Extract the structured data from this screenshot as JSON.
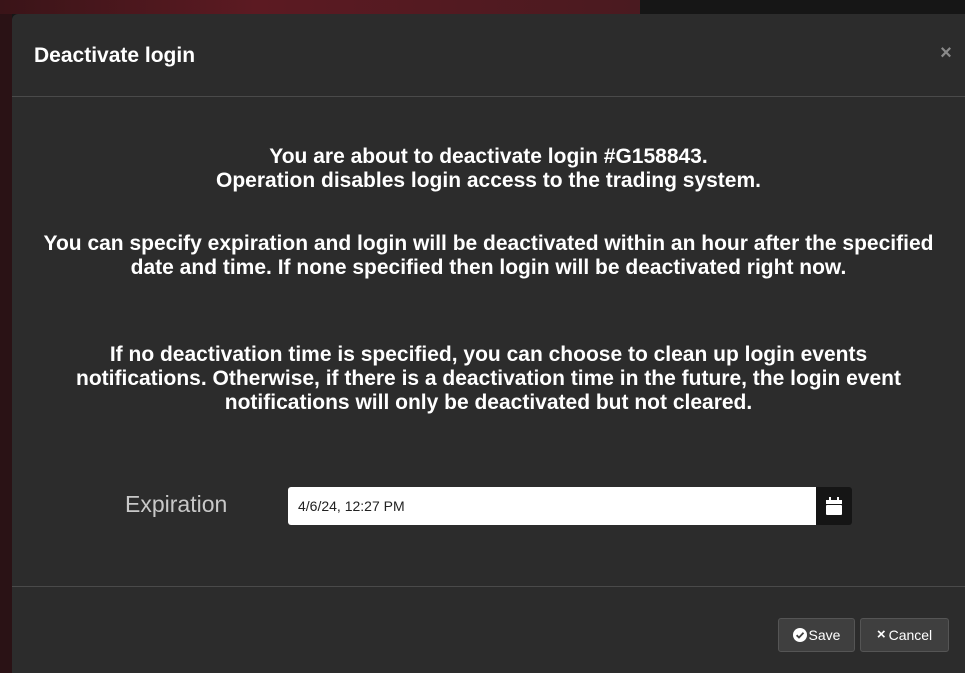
{
  "dialog": {
    "title": "Deactivate login",
    "close_glyph": "×",
    "paragraphs": [
      "You are about to deactivate login #G158843.\nOperation disables login access to the trading system.",
      "You can specify expiration and login will be deactivated within an hour after the specified date and time. If none specified then login will be deactivated right now.",
      "If no deactivation time is specified, you can choose to clean up login events notifications. Otherwise, if there is a deactivation time in the future, the login event notifications will only be deactivated but not cleared."
    ],
    "expiration": {
      "label": "Expiration",
      "value": "4/6/24, 12:27 PM",
      "calendar_icon": "calendar-icon"
    }
  },
  "footer": {
    "save_label": "Save",
    "save_icon": "check-circle-icon",
    "cancel_label": "Cancel",
    "cancel_glyph": "×"
  },
  "colors": {
    "modal_bg": "#2c2c2c",
    "backdrop_accent": "#5c1a22",
    "text": "#ffffff",
    "button_bg": "#3f3f3f"
  }
}
